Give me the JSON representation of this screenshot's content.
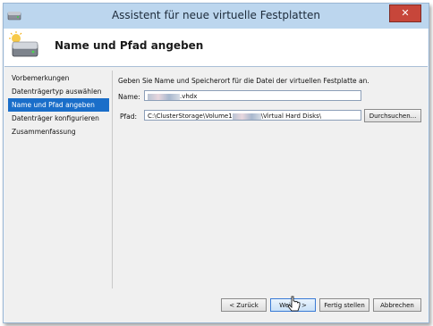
{
  "window": {
    "title": "Assistent für neue virtuelle Festplatten",
    "close_glyph": "✕"
  },
  "header": {
    "title": "Name und Pfad angeben",
    "icon": "hard-drive-icon"
  },
  "nav": {
    "items": [
      {
        "label": "Vorbemerkungen",
        "active": false
      },
      {
        "label": "Datenträgertyp auswählen",
        "active": false
      },
      {
        "label": "Name und Pfad angeben",
        "active": true
      },
      {
        "label": "Datenträger konfigurieren",
        "active": false
      },
      {
        "label": "Zusammenfassung",
        "active": false
      }
    ]
  },
  "main": {
    "instruction": "Geben Sie Name und Speicherort für die Datei der virtuellen Festplatte an.",
    "name_label": "Name:",
    "name_value_suffix": ".vhdx",
    "path_label": "Pfad:",
    "path_value_prefix": "C:\\ClusterStorage\\Volume1",
    "path_value_suffix": "\\Virtual Hard Disks\\",
    "browse_label": "Durchsuchen..."
  },
  "buttons": {
    "back": "< Zurück",
    "next": "Weiter >",
    "finish": "Fertig stellen",
    "cancel": "Abbrechen"
  }
}
